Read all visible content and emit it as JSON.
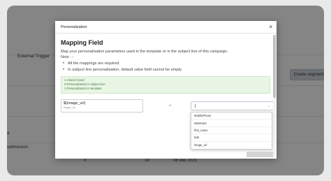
{
  "background_page": {
    "external_trigger": "External Trigger",
    "create_segment": "Create segment",
    "row_label_1": "a",
    "row_label_2": "submission",
    "row_hash": "#",
    "row_count": "18",
    "row_date": "08 Dec 2021"
  },
  "modal": {
    "title": "Personalization",
    "close": "×",
    "heading": "Mapping Field",
    "description": "Map your personalisation parameters used in the template or in the subject line of this campaign.",
    "note_label": "Note : -",
    "notes": [
      "All the mappings are required.",
      "In subject line personalisation, default value field cannot be empty."
    ],
    "success_lines": [
      "1 column found",
      "0 Personalization in subject line",
      "1 Personalization in template"
    ],
    "mapping": {
      "param_name": "$(image_url)",
      "param_sub": "image_url",
      "separator": "–",
      "select_value": "|",
      "options": [
        "MobilePhone",
        "isDeleted",
        "first_name",
        "bab",
        "image_url"
      ]
    }
  }
}
